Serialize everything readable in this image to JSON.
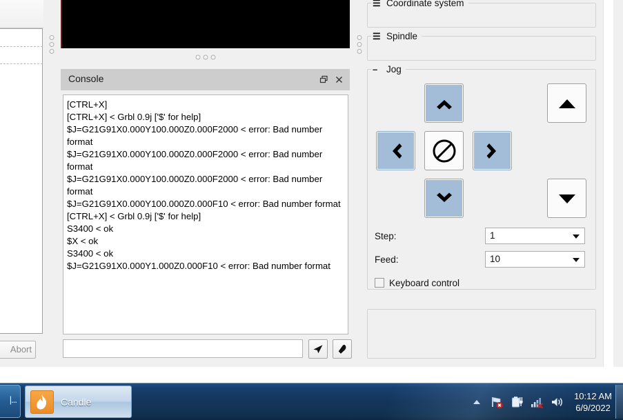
{
  "window": {
    "app_name": "Candle"
  },
  "left_panel": {
    "abort_label": "Abort"
  },
  "console": {
    "title": "Console",
    "float_icon": "restore-icon",
    "close_icon": "close-icon",
    "log": "[CTRL+X]\n[CTRL+X] < Grbl 0.9j ['$' for help]\n$J=G21G91X0.000Y100.000Z0.000F2000 < error: Bad number format\n$J=G21G91X0.000Y100.000Z0.000F2000 < error: Bad number format\n$J=G21G91X0.000Y100.000Z0.000F2000 < error: Bad number format\n$J=G21G91X0.000Y100.000Z0.000F10 < error: Bad number format\n[CTRL+X] < Grbl 0.9j ['$' for help]\nS3400 < ok\n$X < ok\nS3400 < ok\n$J=G21G91X0.000Y1.000Z0.000F10 < error: Bad number format",
    "input_value": "",
    "input_placeholder": "",
    "send_icon": "send-icon",
    "clear_icon": "eraser-icon"
  },
  "right_panel": {
    "groups": [
      {
        "title": "Coordinate system",
        "icon": "hamburger-icon"
      },
      {
        "title": "Spindle",
        "icon": "hamburger-icon"
      },
      {
        "title": "Jog",
        "icon": "minus-icon"
      }
    ],
    "jog": {
      "up_icon": "chevron-up-icon",
      "left_icon": "chevron-left-icon",
      "stop_icon": "no-entry-icon",
      "right_icon": "chevron-right-icon",
      "down_icon": "chevron-down-icon",
      "z_up_icon": "triangle-up-icon",
      "z_down_icon": "triangle-down-icon",
      "step_label": "Step:",
      "step_value": "1",
      "feed_label": "Feed:",
      "feed_value": "10",
      "keyboard_control_label": "Keyboard control",
      "keyboard_control_checked": false
    }
  },
  "taskbar": {
    "start_label": "|...",
    "task_label": "Candle",
    "task_icon": "flame-icon",
    "tray": {
      "show_hidden_icon": "chevron-up-icon",
      "network_icon": "network-error-icon",
      "battery_icon": "battery-plug-icon",
      "signal_icon": "signal-error-icon",
      "volume_icon": "speaker-icon",
      "time": "10:12 AM",
      "date": "6/9/2022"
    }
  },
  "colors": {
    "jog_active": "#a3bdd8",
    "taskbar": "#14355c",
    "candle_accent": "#ec8c27",
    "viewport": "#000000"
  }
}
